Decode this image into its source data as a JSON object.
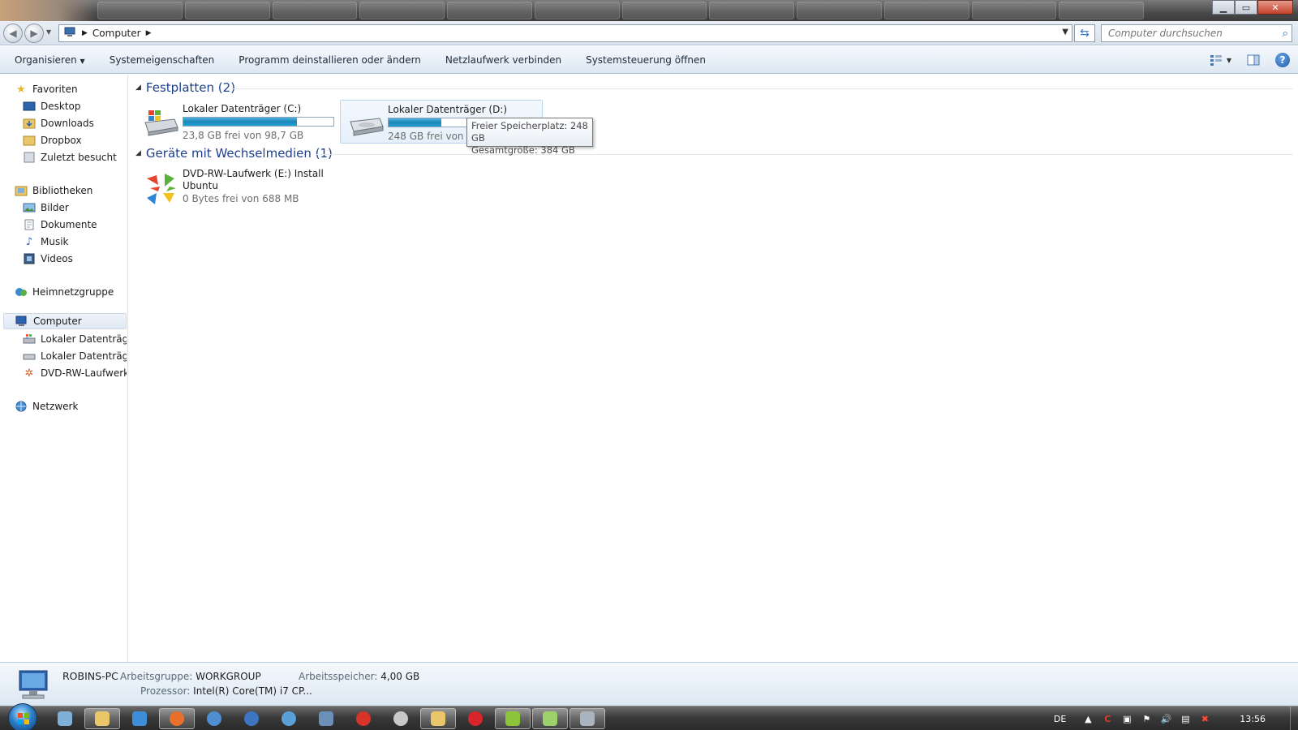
{
  "window": {
    "controls": {
      "minimize": "▁",
      "maximize": "▭",
      "close": "✕"
    }
  },
  "address": {
    "breadcrumb": [
      "Computer"
    ],
    "search_placeholder": "Computer durchsuchen"
  },
  "commands": {
    "organize": "Organisieren",
    "system_properties": "Systemeigenschaften",
    "uninstall": "Programm deinstallieren oder ändern",
    "map_drive": "Netzlaufwerk verbinden",
    "control_panel": "Systemsteuerung öffnen",
    "help": "?"
  },
  "sidebar": {
    "favorites": {
      "label": "Favoriten",
      "items": [
        "Desktop",
        "Downloads",
        "Dropbox",
        "Zuletzt besucht"
      ]
    },
    "libraries": {
      "label": "Bibliotheken",
      "items": [
        "Bilder",
        "Dokumente",
        "Musik",
        "Videos"
      ]
    },
    "homegroup": "Heimnetzgruppe",
    "computer": {
      "label": "Computer",
      "items": [
        "Lokaler Datenträger",
        "Lokaler Datenträger",
        "DVD-RW-Laufwerk ("
      ]
    },
    "network": "Netzwerk"
  },
  "groups": {
    "hard_disks": "Festplatten (2)",
    "removable": "Geräte mit Wechselmedien (1)"
  },
  "drives": [
    {
      "name": "Lokaler Datenträger (C:)",
      "free_text": "23,8 GB frei von 98,7 GB",
      "used_fraction": 0.759
    },
    {
      "name": "Lokaler Datenträger (D:)",
      "free_text": "248 GB frei von 3",
      "used_fraction": 0.354
    }
  ],
  "dvd": {
    "name_line1": "DVD-RW-Laufwerk (E:) Install",
    "name_line2": "Ubuntu",
    "free_text": "0 Bytes frei von 688 MB"
  },
  "tooltip": {
    "line1": "Freier Speicherplatz: 248 GB",
    "line2": "Gesamtgröße: 384 GB"
  },
  "details": {
    "pc_name": "ROBINS-PC",
    "workgroup_label": "Arbeitsgruppe:",
    "workgroup_value": "WORKGROUP",
    "memory_label": "Arbeitsspeicher:",
    "memory_value": "4,00 GB",
    "cpu_label": "Prozessor:",
    "cpu_value": "Intel(R) Core(TM) i7 CP..."
  },
  "taskbar": {
    "language": "DE",
    "time": "13:56",
    "icons": [
      "show-desktop-icon",
      "libraries-icon",
      "dropbox-icon",
      "firefox-icon",
      "thunderbird-icon",
      "maxthon-icon",
      "skype-icon",
      "security-icon",
      "ccleaner-icon",
      "steam-icon",
      "explorer-icon",
      "opera-icon",
      "android-icon",
      "download-icon",
      "volume-app-icon"
    ]
  },
  "colors": {
    "accent_group": "#1e3f8c",
    "bar_fill": "#26a0d4",
    "selection": "#dfe8f3"
  }
}
